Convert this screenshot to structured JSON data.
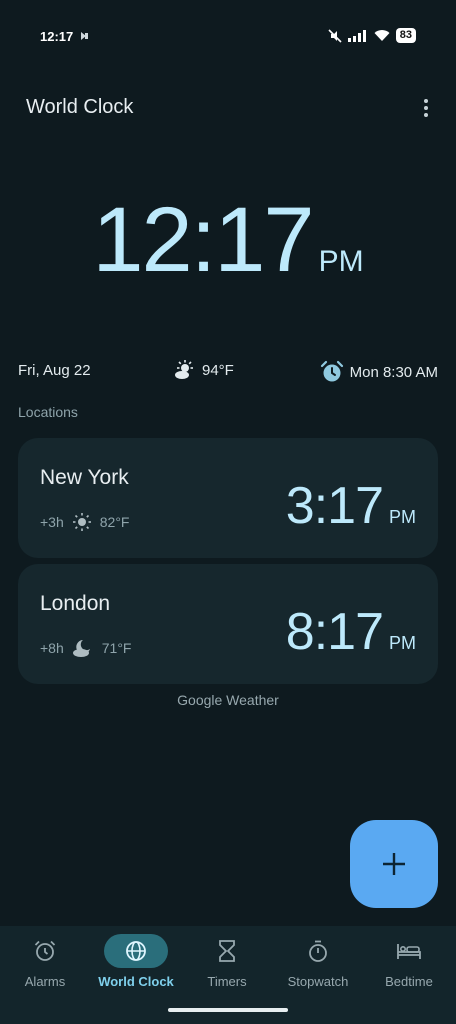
{
  "status_bar": {
    "time": "12:17",
    "battery": "83",
    "icons": [
      "notification-icon",
      "mute-icon",
      "signal-icon",
      "wifi-icon",
      "battery-icon"
    ]
  },
  "header": {
    "title": "World Clock",
    "menu_icon": "more-vert-icon"
  },
  "clock": {
    "time": "12:17",
    "ampm": "PM"
  },
  "info": {
    "date": "Fri, Aug 22",
    "weather_temp": "94°F",
    "next_alarm": "Mon 8:30 AM"
  },
  "locations_label": "Locations",
  "locations": [
    {
      "city": "New York",
      "offset": "+3h",
      "temp": "82°F",
      "time": "3:17",
      "ampm": "PM",
      "weather_icon": "sun-icon"
    },
    {
      "city": "London",
      "offset": "+8h",
      "temp": "71°F",
      "time": "8:17",
      "ampm": "PM",
      "weather_icon": "moon-cloud-icon"
    }
  ],
  "attribution": "Google Weather",
  "fab": {
    "icon": "plus-icon",
    "color": "#5aa9f2"
  },
  "nav": {
    "items": [
      {
        "label": "Alarms",
        "icon": "alarm-icon"
      },
      {
        "label": "World Clock",
        "icon": "globe-icon",
        "active": true
      },
      {
        "label": "Timers",
        "icon": "hourglass-icon"
      },
      {
        "label": "Stopwatch",
        "icon": "stopwatch-icon"
      },
      {
        "label": "Bedtime",
        "icon": "bed-icon"
      }
    ]
  },
  "colors": {
    "background": "#0e1a1f",
    "accent": "#bde9fb",
    "card": "#16272d"
  }
}
